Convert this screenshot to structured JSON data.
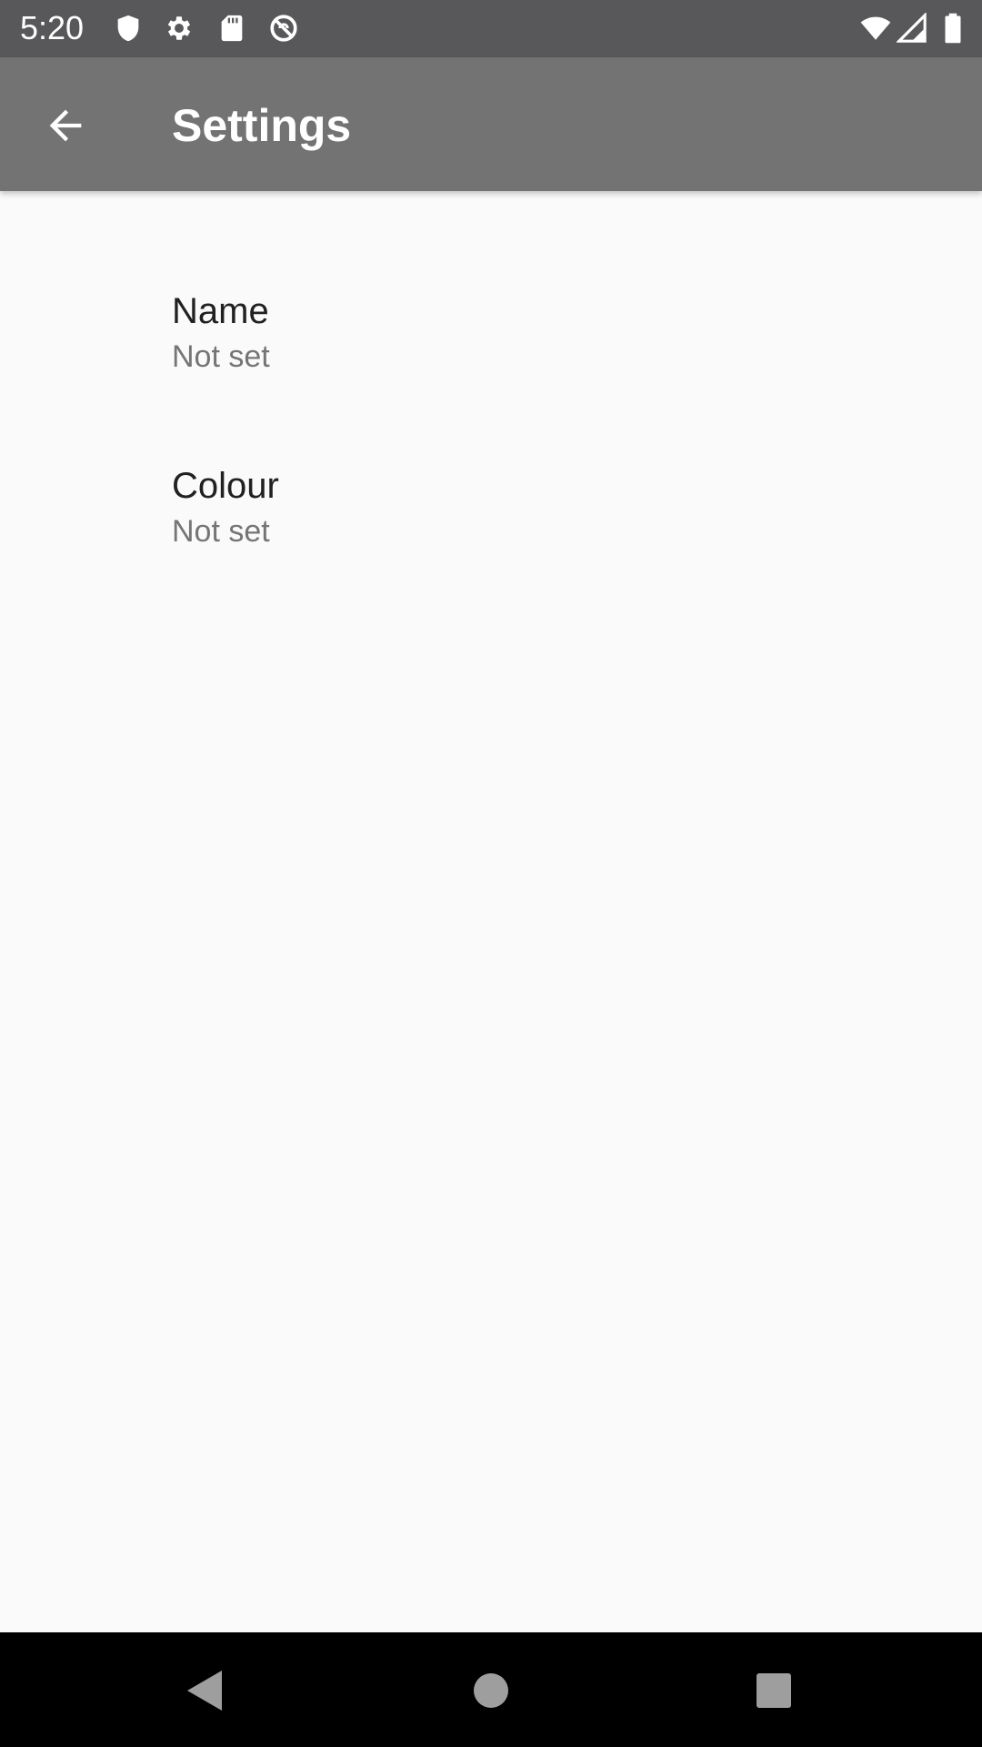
{
  "status_bar": {
    "time": "5:20",
    "left_icons": [
      "shield-icon",
      "gear-icon",
      "sd-card-icon",
      "no-sync-icon"
    ],
    "right_icons": [
      "wifi-icon",
      "signal-icon",
      "battery-icon"
    ]
  },
  "app_bar": {
    "title": "Settings",
    "back_icon": "arrow-back-icon",
    "background_color": "#737373"
  },
  "preferences": [
    {
      "title": "Name",
      "summary": "Not set"
    },
    {
      "title": "Colour",
      "summary": "Not set"
    }
  ],
  "nav_bar": {
    "buttons": [
      "back-triangle-icon",
      "home-circle-icon",
      "recents-square-icon"
    ]
  }
}
